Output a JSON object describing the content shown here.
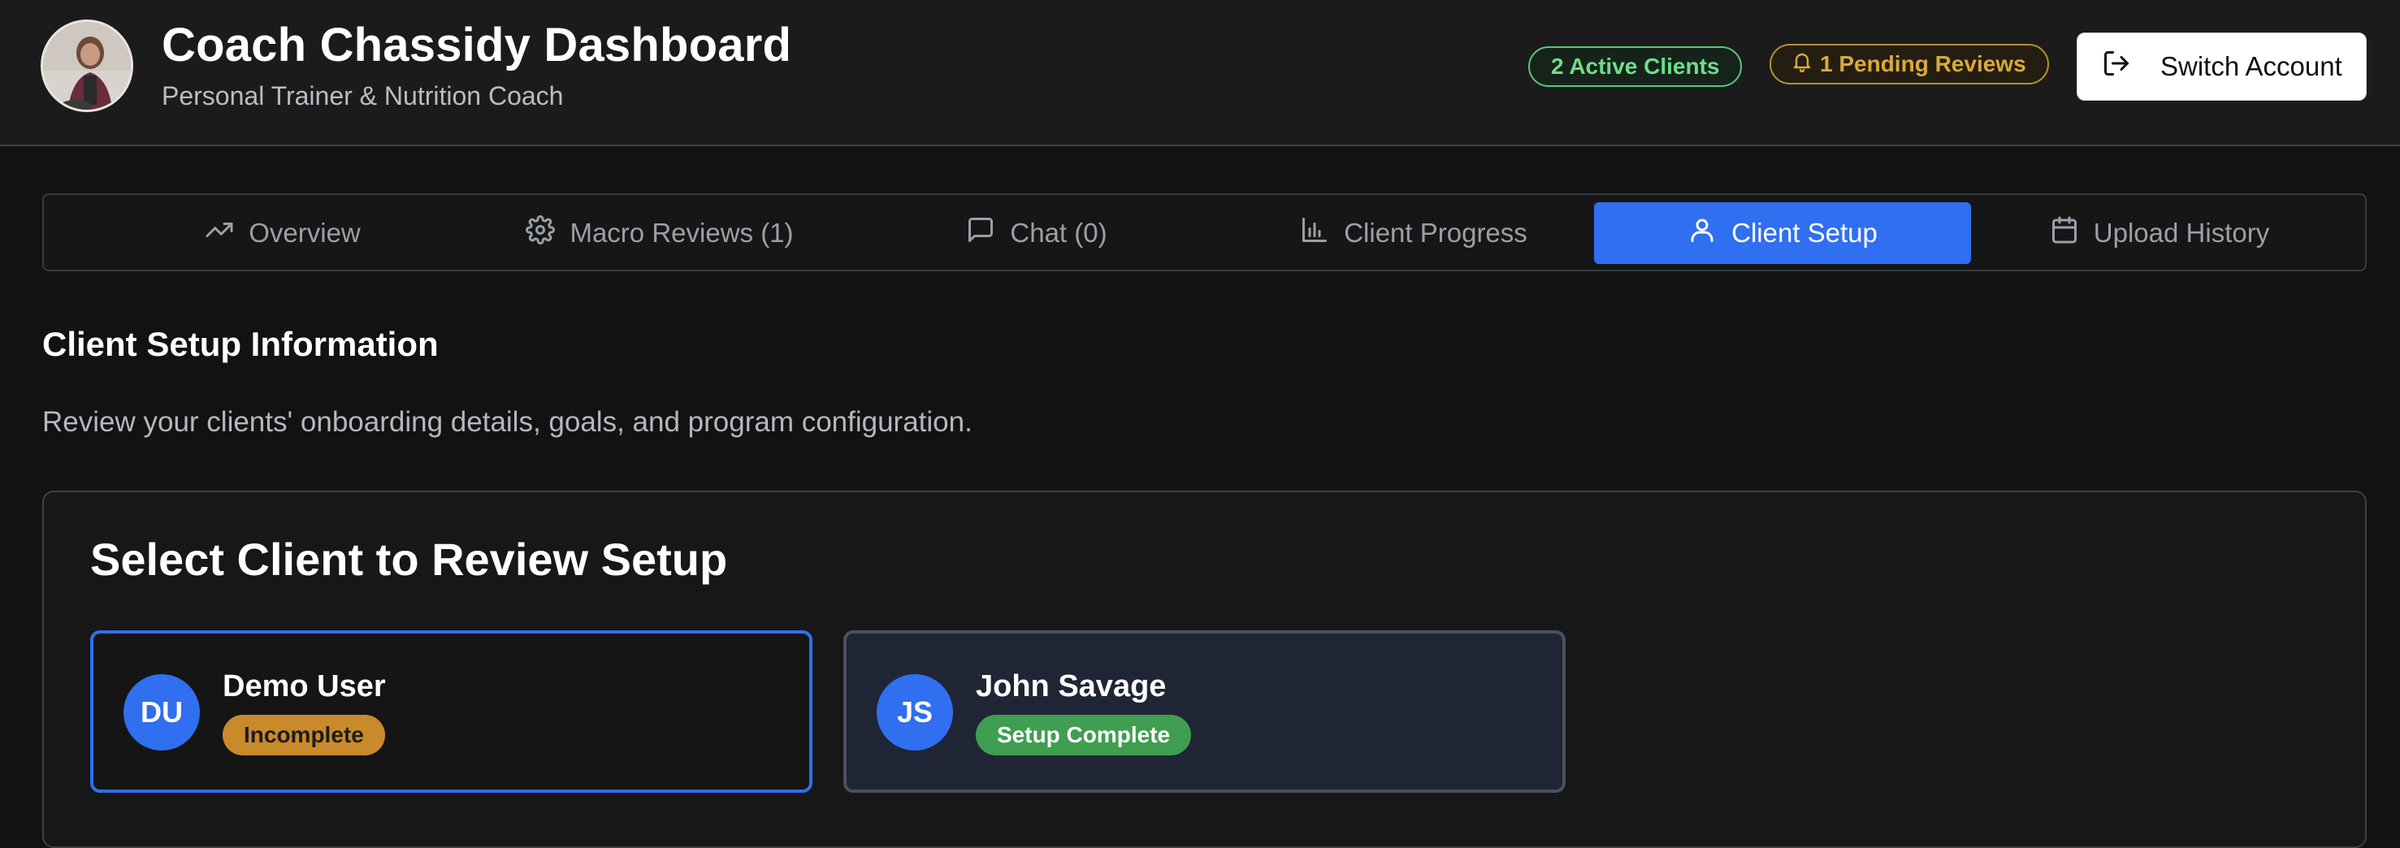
{
  "header": {
    "title": "Coach Chassidy Dashboard",
    "subtitle": "Personal Trainer & Nutrition Coach",
    "active_clients_badge": "2 Active Clients",
    "pending_reviews_badge": "1 Pending Reviews",
    "switch_account_label": "Switch Account"
  },
  "tabs": [
    {
      "label": "Overview",
      "icon": "trending-up-icon",
      "active": false
    },
    {
      "label": "Macro Reviews (1)",
      "icon": "gear-icon",
      "active": false
    },
    {
      "label": "Chat (0)",
      "icon": "chat-bubble-icon",
      "active": false
    },
    {
      "label": "Client Progress",
      "icon": "bar-chart-icon",
      "active": false
    },
    {
      "label": "Client Setup",
      "icon": "user-icon",
      "active": true
    },
    {
      "label": "Upload History",
      "icon": "calendar-icon",
      "active": false
    }
  ],
  "section": {
    "title": "Client Setup Information",
    "description": "Review your clients' onboarding details, goals, and program configuration."
  },
  "panel": {
    "title": "Select Client to Review Setup",
    "clients": [
      {
        "initials": "DU",
        "name": "Demo User",
        "status": "Incomplete",
        "selected": true
      },
      {
        "initials": "JS",
        "name": "John Savage",
        "status": "Setup Complete",
        "selected": false
      }
    ]
  },
  "colors": {
    "accent": "#2f6ff0",
    "success": "#3f9e4f",
    "warning": "#c98a2b",
    "background": "#121212"
  }
}
